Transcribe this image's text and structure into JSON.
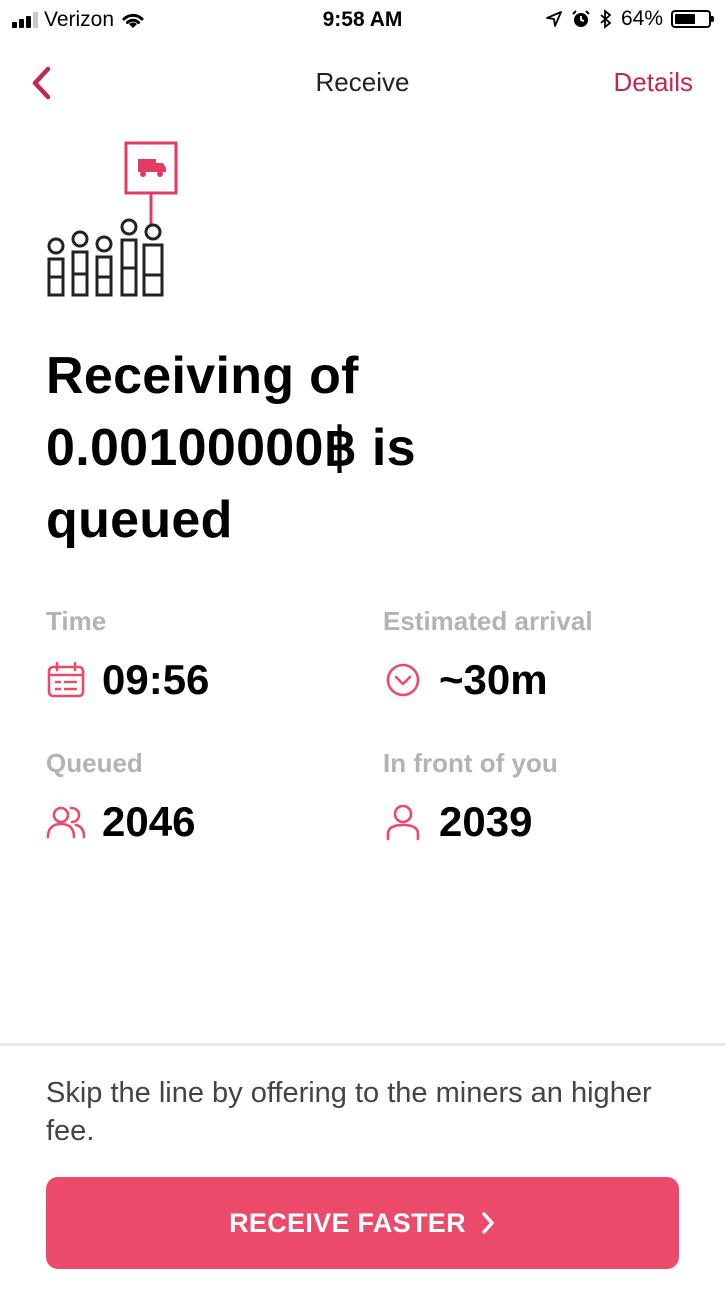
{
  "status_bar": {
    "carrier": "Verizon",
    "time": "9:58 AM",
    "battery_percent": "64%",
    "battery_level": 0.64
  },
  "nav": {
    "title": "Receive",
    "details_label": "Details"
  },
  "headline": {
    "line1": "Receiving of",
    "line2": "0.00100000฿ is",
    "line3": "queued"
  },
  "stats": {
    "time_label": "Time",
    "time_value": "09:56",
    "arrival_label": "Estimated arrival",
    "arrival_value": "~30m",
    "queued_label": "Queued",
    "queued_value": "2046",
    "front_label": "In front of you",
    "front_value": "2039"
  },
  "footer": {
    "hint": "Skip the line by offering to the miners an higher fee.",
    "button_label": "RECEIVE FASTER"
  },
  "colors": {
    "accent": "#ec4a6b",
    "accent_dark": "#c2284f",
    "label_gray": "#b3b3b3"
  },
  "icons": {
    "back": "chevron-left-icon",
    "time": "calendar-icon",
    "arrival": "clock-chevron-icon",
    "queued": "users-icon",
    "front": "user-icon",
    "button": "chevron-right-icon"
  }
}
